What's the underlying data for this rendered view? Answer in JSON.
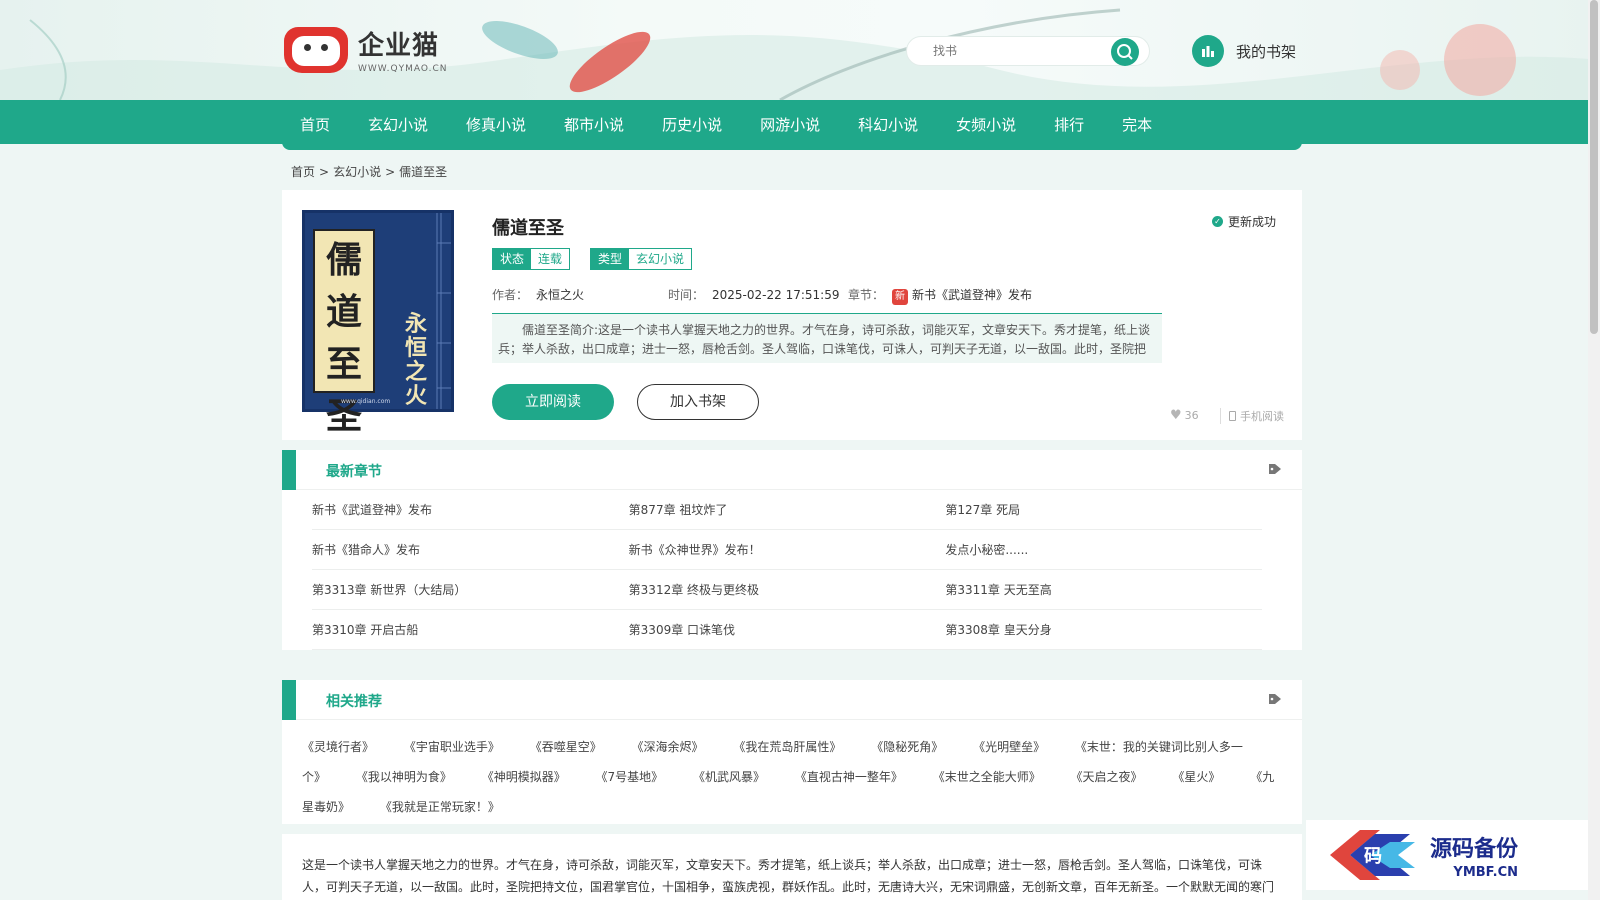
{
  "header": {
    "logo_name": "企业猫",
    "logo_url": "WWW.QYMAO.CN",
    "search": {
      "placeholder": "找书",
      "value": "找书"
    },
    "shelf_label": "我的书架"
  },
  "nav": {
    "items": [
      {
        "label": "首页"
      },
      {
        "label": "玄幻小说"
      },
      {
        "label": "修真小说"
      },
      {
        "label": "都市小说"
      },
      {
        "label": "历史小说"
      },
      {
        "label": "网游小说"
      },
      {
        "label": "科幻小说"
      },
      {
        "label": "女频小说"
      },
      {
        "label": "排行"
      },
      {
        "label": "完本"
      }
    ]
  },
  "breadcrumb": {
    "home": "首页",
    "sep1": ">",
    "category": "玄幻小说",
    "sep2": ">",
    "current": "儒道至圣"
  },
  "book": {
    "cover_title_chars": [
      "儒",
      "道",
      "至",
      "圣"
    ],
    "cover_author": "永恒之火",
    "cover_foot": "www.qidian.com",
    "title": "儒道至圣",
    "update_status": "更新成功",
    "tag_status_key": "状态",
    "tag_status_val": "连载",
    "tag_type_key": "类型",
    "tag_type_val": "玄幻小说",
    "author_label": "作者：",
    "author": "永恒之火",
    "time_label": "时间：",
    "time": "2025-02-22 17:51:59",
    "chapter_label": "章节：",
    "chapter_badge": "新",
    "latest_chapter": "新书《武道登神》发布",
    "intro": "儒道至圣简介:这是一个读书人掌握天地之力的世界。才气在身，诗可杀敌，词能灭军，文章安天下。秀才提笔，纸上谈兵；举人杀敌，出口成章；进士一怒，唇枪舌剑。圣人驾临，口诛笔伐，可诛人，可判天子无道，以一敌国。此时，圣院把",
    "read_button": "立即阅读",
    "shelf_button": "加入书架",
    "likes": "36",
    "mobile_read": "手机阅读"
  },
  "latest_section": {
    "title": "最新章节",
    "rows": [
      [
        "新书《武道登神》发布",
        "第877章 祖坟炸了",
        "第127章 死局"
      ],
      [
        "新书《猎命人》发布",
        "新书《众神世界》发布！",
        "发点小秘密......"
      ],
      [
        "第3313章 新世界（大结局）",
        "第3312章 终极与更终极",
        "第3311章 天无至高"
      ],
      [
        "第3310章 开启古船",
        "第3309章 口诛笔伐",
        "第3308章 皇天分身"
      ]
    ]
  },
  "recommend_section": {
    "title": "相关推荐",
    "items": [
      "《灵境行者》",
      "《宇宙职业选手》",
      "《吞噬星空》",
      "《深海余烬》",
      "《我在荒岛肝属性》",
      "《隐秘死角》",
      "《光明壁垒》",
      "《末世：我的关键词比别人多一个》",
      "《我以神明为食》",
      "《神明模拟器》",
      "《7号基地》",
      "《机武风暴》",
      "《直视古神一整年》",
      "《末世之全能大师》",
      "《天启之夜》",
      "《星火》",
      "《九星毒奶》",
      "《我就是正常玩家！》"
    ]
  },
  "full_intro": "这是一个读书人掌握天地之力的世界。才气在身，诗可杀敌，词能灭军，文章安天下。秀才提笔，纸上谈兵；举人杀敌，出口成章；进士一怒，唇枪舌剑。圣人驾临，口诛笔伐，可诛人，可判天子无道，以一敌国。此时，圣院把持文位，国君掌官位，十国相争，蛮族虎视，群妖作乱。此时，无唐诗大兴，无宋词鼎盛，无创新文章，百年无新圣。一个默默无闻的寒门",
  "watermark": {
    "cn": "源码备份",
    "en": "YMBF.CN"
  },
  "colors": {
    "accent": "#1fa88a",
    "badge_red": "#e0453d"
  }
}
